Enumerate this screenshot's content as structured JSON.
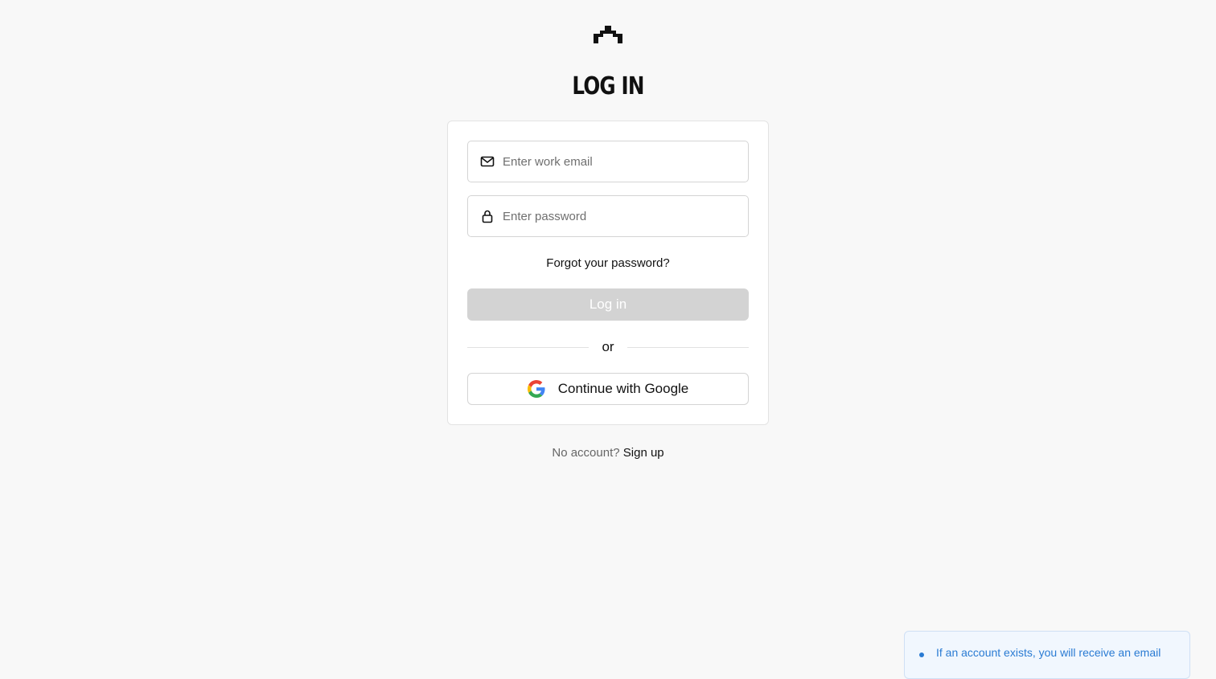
{
  "header": {
    "logo_icon": "brand-logo-icon",
    "title": "LOG IN"
  },
  "form": {
    "email": {
      "icon": "mail-icon",
      "placeholder": "Enter work email",
      "value": ""
    },
    "password": {
      "icon": "lock-icon",
      "placeholder": "Enter password",
      "value": ""
    },
    "forgot_label": "Forgot your password?",
    "login_label": "Log in",
    "divider_label": "or",
    "google": {
      "icon": "google-icon",
      "label": "Continue with Google"
    }
  },
  "footer": {
    "prompt": "No account?",
    "signup_label": "Sign up"
  },
  "toast": {
    "icon": "info-icon",
    "message": "If an account exists, you will receive an email"
  },
  "colors": {
    "background": "#f8f8f8",
    "disabled_button": "#d3d3d3",
    "toast_text": "#2a7bd3"
  }
}
